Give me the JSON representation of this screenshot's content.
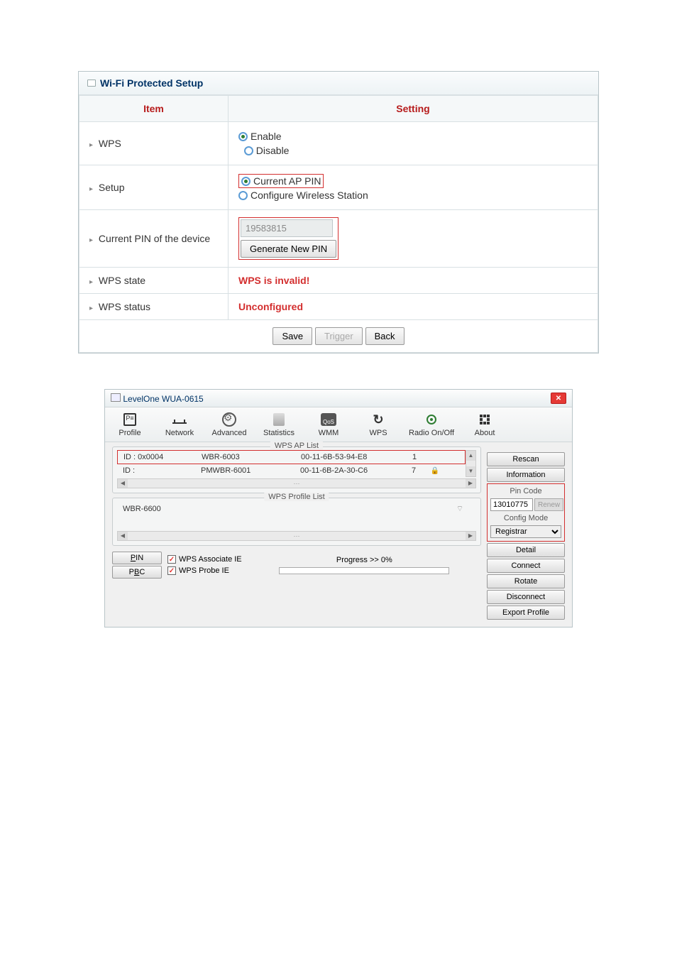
{
  "wps_panel": {
    "title": "Wi-Fi Protected Setup",
    "col_item": "Item",
    "col_setting": "Setting",
    "rows": {
      "wps": {
        "label": "WPS",
        "enable": "Enable",
        "disable": "Disable"
      },
      "setup": {
        "label": "Setup",
        "current_ap_pin": "Current AP PIN",
        "configure_station": "Configure Wireless Station"
      },
      "current_pin": {
        "label": "Current PIN of the device",
        "pin_value": "19583815",
        "generate_btn": "Generate New PIN"
      },
      "wps_state": {
        "label": "WPS state",
        "value": "WPS is invalid!"
      },
      "wps_status": {
        "label": "WPS status",
        "value": "Unconfigured"
      }
    },
    "buttons": {
      "save": "Save",
      "trigger": "Trigger",
      "back": "Back"
    }
  },
  "app": {
    "title": "LevelOne WUA-0615",
    "toolbar": {
      "profile": "Profile",
      "network": "Network",
      "advanced": "Advanced",
      "statistics": "Statistics",
      "wmm": "WMM",
      "wps": "WPS",
      "radio": "Radio On/Off",
      "about": "About",
      "wmm_badge": "QoS"
    },
    "wps_ap_list": {
      "label": "WPS AP List",
      "rows": [
        {
          "id": "ID : 0x0004",
          "name": "WBR-6003",
          "mac": "00-11-6B-53-94-E8",
          "num": "1",
          "locked": false
        },
        {
          "id": "ID :",
          "name": "PMWBR-6001",
          "mac": "00-11-6B-2A-30-C6",
          "num": "7",
          "locked": true
        }
      ]
    },
    "wps_profile_list": {
      "label": "WPS Profile List",
      "rows": [
        {
          "name": "WBR-6600"
        }
      ]
    },
    "side": {
      "rescan": "Rescan",
      "information": "Information",
      "pin_code_label": "Pin Code",
      "pin_code_value": "13010775",
      "renew": "Renew",
      "config_mode_label": "Config Mode",
      "config_mode_value": "Registrar",
      "detail": "Detail",
      "connect": "Connect",
      "rotate": "Rotate",
      "disconnect": "Disconnect",
      "export_profile": "Export Profile"
    },
    "bottom": {
      "pin": "PIN",
      "pbc": "PBC",
      "wps_associate": "WPS Associate IE",
      "wps_probe": "WPS Probe IE",
      "progress": "Progress >> 0%"
    }
  }
}
